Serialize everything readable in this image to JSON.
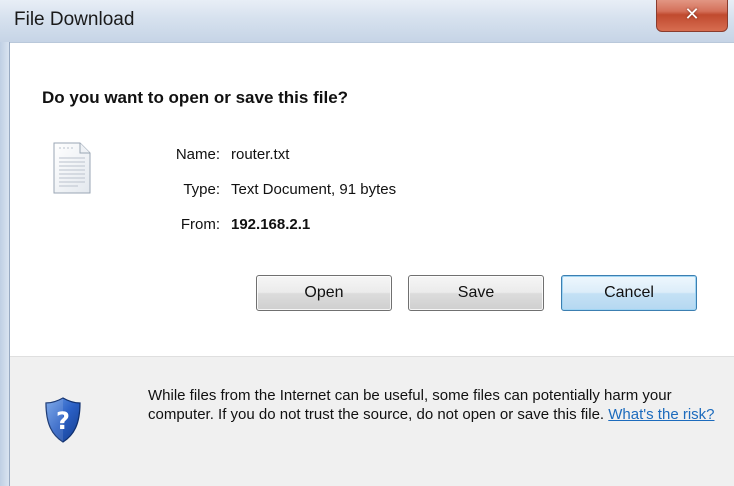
{
  "window": {
    "title": "File Download",
    "close_label": "✕"
  },
  "dialog": {
    "heading": "Do you want to open or save this file?",
    "file_icon": "text-document-icon",
    "fields": {
      "name_label": "Name:",
      "name_value": "router.txt",
      "type_label": "Type:",
      "type_value": "Text Document, 91 bytes",
      "from_label": "From:",
      "from_value": "192.168.2.1"
    },
    "buttons": {
      "open": "Open",
      "save": "Save",
      "cancel": "Cancel"
    },
    "footer": {
      "icon": "security-shield-question-icon",
      "warning_text": "While files from the Internet can be useful, some files can potentially harm your computer. If you do not trust the source, do not open or save this file.",
      "risk_link": "What's the risk?"
    }
  },
  "colors": {
    "link": "#1c6bbd",
    "default_button_border": "#3c7fb1",
    "footer_background": "#f0f0f0",
    "close_button": "#c04a2f"
  }
}
